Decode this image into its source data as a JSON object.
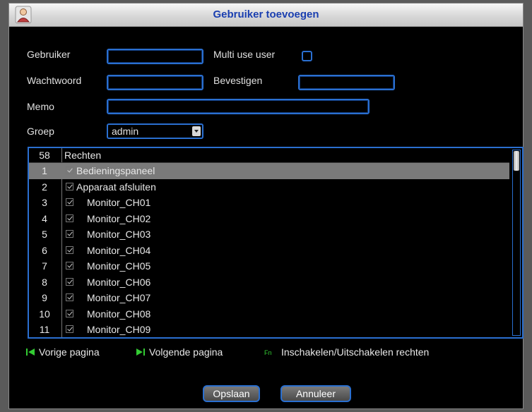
{
  "window": {
    "title": "Gebruiker toevoegen"
  },
  "form": {
    "user_label": "Gebruiker",
    "user_value": "",
    "multi_use_label": "Multi use user",
    "password_label": "Wachtwoord",
    "confirm_label": "Bevestigen",
    "memo_label": "Memo",
    "group_label": "Groep",
    "group_value": "admin"
  },
  "rights": {
    "count": "58",
    "header": "Rechten",
    "rows": [
      {
        "num": "1",
        "label": "Bedieningspaneel",
        "indent": false,
        "selected": true
      },
      {
        "num": "2",
        "label": "Apparaat afsluiten",
        "indent": false,
        "selected": false
      },
      {
        "num": "3",
        "label": "Monitor_CH01",
        "indent": true,
        "selected": false
      },
      {
        "num": "4",
        "label": "Monitor_CH02",
        "indent": true,
        "selected": false
      },
      {
        "num": "5",
        "label": "Monitor_CH03",
        "indent": true,
        "selected": false
      },
      {
        "num": "6",
        "label": "Monitor_CH04",
        "indent": true,
        "selected": false
      },
      {
        "num": "7",
        "label": "Monitor_CH05",
        "indent": true,
        "selected": false
      },
      {
        "num": "8",
        "label": "Monitor_CH06",
        "indent": true,
        "selected": false
      },
      {
        "num": "9",
        "label": "Monitor_CH07",
        "indent": true,
        "selected": false
      },
      {
        "num": "10",
        "label": "Monitor_CH08",
        "indent": true,
        "selected": false
      },
      {
        "num": "11",
        "label": "Monitor_CH09",
        "indent": true,
        "selected": false
      }
    ]
  },
  "nav": {
    "prev_label": "Vorige pagina",
    "next_label": "Volgende pagina",
    "toggle_label": "Inschakelen/Uitschakelen rechten"
  },
  "buttons": {
    "save_label": "Opslaan",
    "cancel_label": "Annuleer"
  },
  "colors": {
    "accent": "#2a6fd0",
    "nav_icon": "#33cc33",
    "title": "#1a3fb0"
  }
}
